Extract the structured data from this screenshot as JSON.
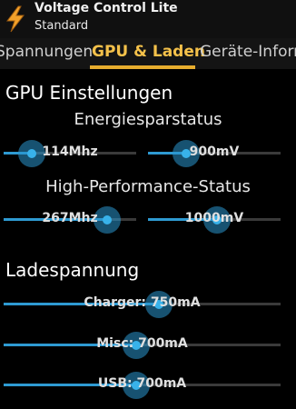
{
  "app": {
    "title": "Voltage Control Lite",
    "subtitle": "Standard",
    "icon": "lightning-app-icon"
  },
  "tabs": [
    {
      "label": "Spannungen",
      "active": false
    },
    {
      "label": "GPU & Laden",
      "active": true
    },
    {
      "label": "Geräte-Inform",
      "active": false
    }
  ],
  "gpu": {
    "heading": "GPU Einstellungen",
    "power_saving": {
      "title": "Energiesparstatus",
      "freq": {
        "label": "114Mhz",
        "fraction": 0.21
      },
      "volt": {
        "label": "900mV",
        "fraction": 0.29
      }
    },
    "high_performance": {
      "title": "High-Performance-Status",
      "freq": {
        "label": "267Mhz",
        "fraction": 0.78
      },
      "volt": {
        "label": "1000mV",
        "fraction": 0.52
      }
    }
  },
  "charging": {
    "heading": "Ladespannung",
    "charger": {
      "label": "Charger: 750mA",
      "fraction": 0.56
    },
    "misc": {
      "label": "Misc: 700mA",
      "fraction": 0.48
    },
    "usb": {
      "label": "USB: 700mA",
      "fraction": 0.48
    }
  },
  "colors": {
    "accent": "#2e9ad2",
    "tab_active": "#f4c14a",
    "tab_indicator": "#e7ad2e",
    "background": "#000000"
  }
}
